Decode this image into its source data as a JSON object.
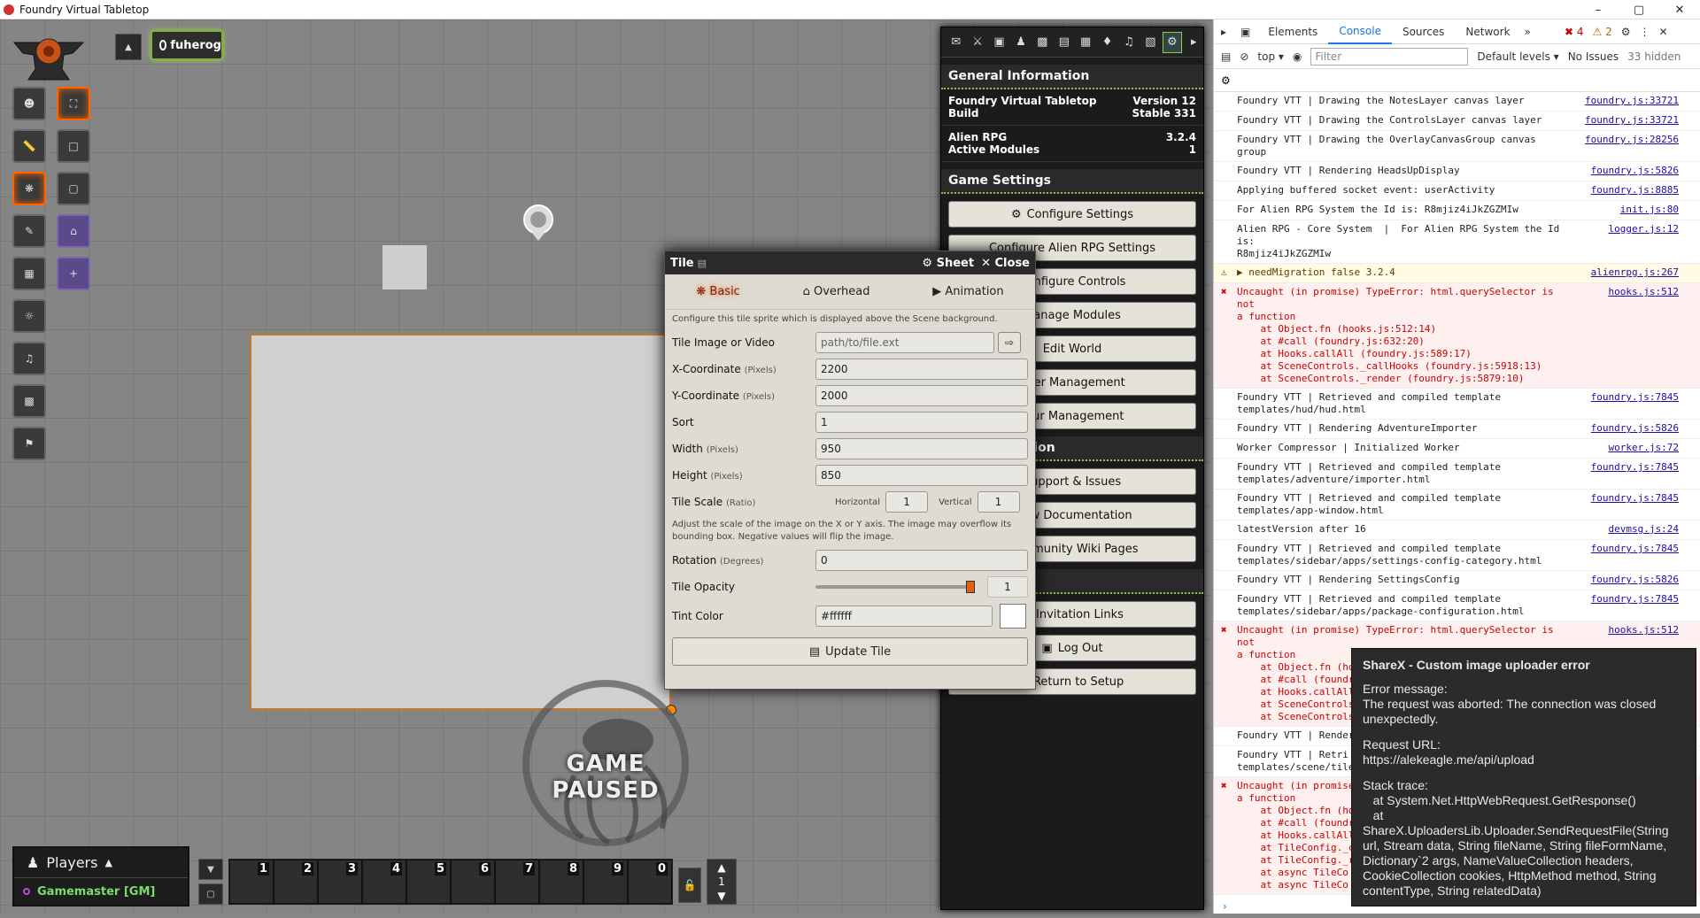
{
  "window": {
    "title": "Foundry Virtual Tabletop"
  },
  "user": {
    "name": "fuherog"
  },
  "scene": {
    "paused_text": "GAME PAUSED"
  },
  "players": {
    "header": "Players",
    "gm": "Gamemaster [GM]"
  },
  "hotbar": {
    "slots": [
      "1",
      "2",
      "3",
      "4",
      "5",
      "6",
      "7",
      "8",
      "9",
      "0"
    ],
    "page": "1"
  },
  "sidebar": {
    "general_info": "General Information",
    "fvtt_label": "Foundry Virtual Tabletop Build",
    "fvtt_version": "Version 12 Stable 331",
    "system_label": "Alien RPG",
    "system_version": "3.2.4",
    "modules_label": "Active Modules",
    "modules_count": "1",
    "game_settings": "Game Settings",
    "buttons": [
      "Configure Settings",
      "Configure Alien RPG Settings",
      "Configure Controls",
      "Manage Modules",
      "Edit World",
      "User Management",
      "Tour Management"
    ],
    "documentation": "Documentation",
    "doc_buttons": [
      "Support & Issues",
      "View Documentation",
      "Community Wiki Pages"
    ],
    "access_buttons": [
      "Invitation Links",
      "Log Out",
      "Return to Setup"
    ]
  },
  "tile": {
    "title": "Tile",
    "sheet": "Sheet",
    "close": "Close",
    "tabs": [
      "Basic",
      "Overhead",
      "Animation"
    ],
    "hint": "Configure this tile sprite which is displayed above the Scene background.",
    "image_label": "Tile Image or Video",
    "image_placeholder": "path/to/file.ext",
    "x_label": "X-Coordinate",
    "x_unit": "(Pixels)",
    "x_value": "2200",
    "y_label": "Y-Coordinate",
    "y_unit": "(Pixels)",
    "y_value": "2000",
    "sort_label": "Sort",
    "sort_value": "1",
    "width_label": "Width",
    "width_unit": "(Pixels)",
    "width_value": "950",
    "height_label": "Height",
    "height_unit": "(Pixels)",
    "height_value": "850",
    "scale_label": "Tile Scale",
    "scale_unit": "(Ratio)",
    "horizontal": "Horizontal",
    "horizontal_value": "1",
    "vertical": "Vertical",
    "vertical_value": "1",
    "scale_hint": "Adjust the scale of the image on the X or Y axis. The image may overflow its bounding box. Negative values will flip the image.",
    "rotation_label": "Rotation",
    "rotation_unit": "(Degrees)",
    "rotation_value": "0",
    "opacity_label": "Tile Opacity",
    "opacity_value": "1",
    "tint_label": "Tint Color",
    "tint_value": "#ffffff",
    "update": "Update Tile"
  },
  "devtools": {
    "tabs": [
      "Elements",
      "Console",
      "Sources",
      "Network"
    ],
    "errors": "4",
    "warnings": "2",
    "context": "top",
    "filter_placeholder": "Filter",
    "levels": "Default levels",
    "issues": "No Issues",
    "hidden": "33 hidden",
    "messages": [
      {
        "text": "Foundry VTT | Drawing the NotesLayer canvas layer",
        "src": "foundry.js:33721",
        "type": "log"
      },
      {
        "text": "Foundry VTT | Drawing the ControlsLayer canvas layer",
        "src": "foundry.js:33721",
        "type": "log"
      },
      {
        "text": "Foundry VTT | Drawing the OverlayCanvasGroup canvas\ngroup",
        "src": "foundry.js:28256",
        "type": "log"
      },
      {
        "text": "Foundry VTT | Rendering HeadsUpDisplay",
        "src": "foundry.js:5826",
        "type": "log"
      },
      {
        "text": "Applying buffered socket event: userActivity",
        "src": "foundry.js:8885",
        "type": "log"
      },
      {
        "text": "For Alien RPG System the Id is: R8mjiz4iJkZGZMIw",
        "src": "init.js:80",
        "type": "log"
      },
      {
        "text": "Alien RPG - Core System  |  For Alien RPG System the Id is:\nR8mjiz4iJkZGZMIw",
        "src": "logger.js:12",
        "type": "log"
      },
      {
        "text": "▶ needMigration false 3.2.4",
        "src": "alienrpg.js:267",
        "type": "warn"
      },
      {
        "text": "Uncaught (in promise) TypeError: html.querySelector is not\na function\n    at Object.fn (hooks.js:512:14)\n    at #call (foundry.js:632:20)\n    at Hooks.callAll (foundry.js:589:17)\n    at SceneControls._callHooks (foundry.js:5918:13)\n    at SceneControls._render (foundry.js:5879:10)",
        "src": "hooks.js:512",
        "type": "err"
      },
      {
        "text": "Foundry VTT | Retrieved and compiled template\ntemplates/hud/hud.html",
        "src": "foundry.js:7845",
        "type": "log"
      },
      {
        "text": "Foundry VTT | Rendering AdventureImporter",
        "src": "foundry.js:5826",
        "type": "log"
      },
      {
        "text": "Worker Compressor | Initialized Worker",
        "src": "worker.js:72",
        "type": "log"
      },
      {
        "text": "Foundry VTT | Retrieved and compiled template\ntemplates/adventure/importer.html",
        "src": "foundry.js:7845",
        "type": "log"
      },
      {
        "text": "Foundry VTT | Retrieved and compiled template\ntemplates/app-window.html",
        "src": "foundry.js:7845",
        "type": "log"
      },
      {
        "text": "latestVersion after 16",
        "src": "devmsg.js:24",
        "type": "log"
      },
      {
        "text": "Foundry VTT | Retrieved and compiled template\ntemplates/sidebar/apps/settings-config-category.html",
        "src": "foundry.js:7845",
        "type": "log"
      },
      {
        "text": "Foundry VTT | Rendering SettingsConfig",
        "src": "foundry.js:5826",
        "type": "log"
      },
      {
        "text": "Foundry VTT | Retrieved and compiled template\ntemplates/sidebar/apps/package-configuration.html",
        "src": "foundry.js:7845",
        "type": "log"
      },
      {
        "text": "Uncaught (in promise) TypeError: html.querySelector is not\na function\n    at Object.fn (hooks.js:512:14)\n    at #call (foundry.js:632:20)\n    at Hooks.callAll\n    at SceneControls\n    at SceneControls",
        "src": "hooks.js:512",
        "type": "err"
      },
      {
        "text": "Foundry VTT | Render",
        "src": "",
        "type": "log"
      },
      {
        "text": "Foundry VTT | Retri\ntemplates/scene/tile",
        "src": "",
        "type": "log"
      },
      {
        "text": "Uncaught (in promise)\na function\n    at Object.fn (ho\n    at #call (foundr\n    at Hooks.callAll\n    at TileConfig._c\n    at TileConfig._r\n    at async TileCo\n    at async TileCo",
        "src": "",
        "type": "err"
      }
    ]
  },
  "sharex": {
    "title": "ShareX - Custom image uploader error",
    "l1": "Error message:",
    "l2": "The request was aborted: The connection was closed unexpectedly.",
    "l3": "Request URL:",
    "l4": "https://alekeagle.me/api/upload",
    "l5": "Stack trace:",
    "l6": "   at System.Net.HttpWebRequest.GetResponse()",
    "l7": "   at",
    "l8": "ShareX.UploadersLib.Uploader.SendRequestFile(String url, Stream data, String fileName, String fileFormName, Dictionary`2 args, NameValueCollection headers, CookieCollection cookies, HttpMethod method, String contentType, String relatedData)"
  }
}
